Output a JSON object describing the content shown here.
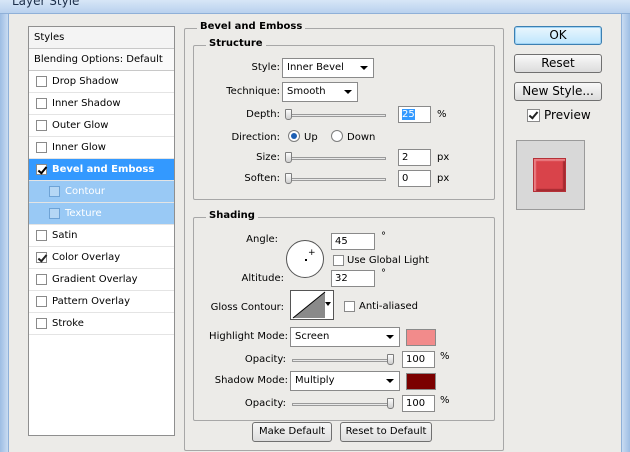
{
  "window": {
    "title": "Layer Style"
  },
  "styles_panel": {
    "header": "Styles",
    "blending_options": "Blending Options: Default",
    "items": [
      {
        "label": "Drop Shadow",
        "checked": false
      },
      {
        "label": "Inner Shadow",
        "checked": false
      },
      {
        "label": "Outer Glow",
        "checked": false
      },
      {
        "label": "Inner Glow",
        "checked": false
      },
      {
        "label": "Bevel and Emboss",
        "checked": true
      },
      {
        "label": "Contour",
        "checked": false
      },
      {
        "label": "Texture",
        "checked": false
      },
      {
        "label": "Satin",
        "checked": false
      },
      {
        "label": "Color Overlay",
        "checked": true
      },
      {
        "label": "Gradient Overlay",
        "checked": false
      },
      {
        "label": "Pattern Overlay",
        "checked": false
      },
      {
        "label": "Stroke",
        "checked": false
      }
    ]
  },
  "bevel": {
    "title": "Bevel and Emboss",
    "structure": {
      "title": "Structure",
      "style_label": "Style:",
      "style_value": "Inner Bevel",
      "technique_label": "Technique:",
      "technique_value": "Smooth",
      "depth_label": "Depth:",
      "depth_value": "25",
      "depth_unit": "%",
      "direction_label": "Direction:",
      "direction_up": "Up",
      "direction_down": "Down",
      "size_label": "Size:",
      "size_value": "2",
      "size_unit": "px",
      "soften_label": "Soften:",
      "soften_value": "0",
      "soften_unit": "px"
    },
    "shading": {
      "title": "Shading",
      "angle_label": "Angle:",
      "angle_value": "45",
      "degree": "°",
      "global_light_label": "Use Global Light",
      "altitude_label": "Altitude:",
      "altitude_value": "32",
      "gloss_contour_label": "Gloss Contour:",
      "anti_aliased_label": "Anti-aliased",
      "highlight_mode_label": "Highlight Mode:",
      "highlight_mode_value": "Screen",
      "highlight_color": "#f28b8b",
      "highlight_opacity_label": "Opacity:",
      "highlight_opacity_value": "100",
      "shadow_mode_label": "Shadow Mode:",
      "shadow_mode_value": "Multiply",
      "shadow_color": "#7b0000",
      "shadow_opacity_label": "Opacity:",
      "shadow_opacity_value": "100",
      "percent": "%"
    },
    "make_default": "Make Default",
    "reset_default": "Reset to Default"
  },
  "buttons": {
    "ok": "OK",
    "reset": "Reset",
    "new_style": "New Style...",
    "preview": "Preview"
  },
  "colors": {
    "selected_row": "#3399ff",
    "preview_swatch": "#d9434a"
  }
}
